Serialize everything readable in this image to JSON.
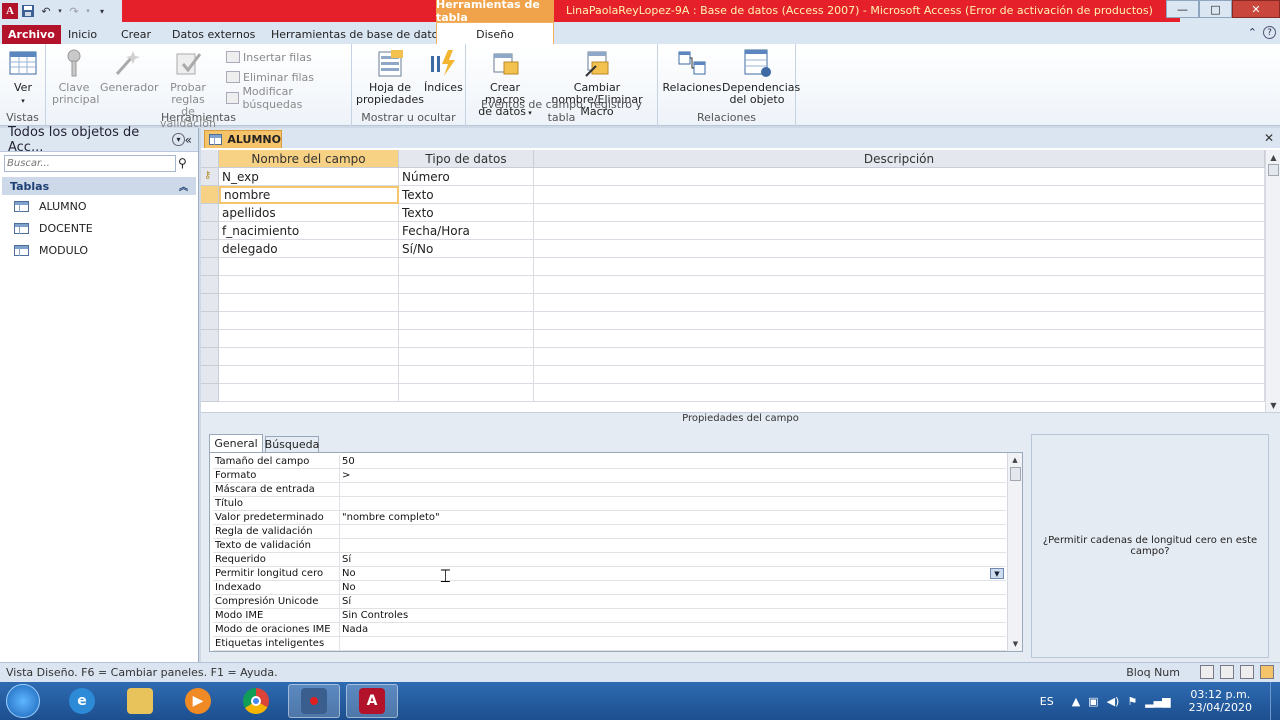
{
  "window": {
    "title": "LinaPaolaReyLopez-9A : Base de datos (Access 2007) -  Microsoft Access (Error de activación de productos)",
    "context_tab_header": "Herramientas de tabla",
    "min": "—",
    "max": "□",
    "close": "✕"
  },
  "ribbon_tabs": {
    "file": "Archivo",
    "home": "Inicio",
    "create": "Crear",
    "external": "Datos externos",
    "dbtools": "Herramientas de base de datos",
    "design": "Diseño",
    "help": "?"
  },
  "ribbon": {
    "views": {
      "view": "Ver",
      "label": "Vistas"
    },
    "tools": {
      "primary_key": "Clave\nprincipal",
      "builder": "Generador",
      "test_rules": "Probar reglas\nde validación",
      "insert_rows": "Insertar filas",
      "delete_rows": "Eliminar filas",
      "modify_lookups": "Modificar búsquedas",
      "label": "Herramientas"
    },
    "show_hide": {
      "property_sheet": "Hoja de\npropiedades",
      "indexes": "Índices",
      "label": "Mostrar u ocultar"
    },
    "events": {
      "create_macros": "Crear macros\nde datos",
      "rename_macro": "Cambiar\nnombre/Eliminar Macro",
      "label": "Eventos de campo, registro y tabla"
    },
    "relationships": {
      "relationships": "Relaciones",
      "dependencies": "Dependencias\ndel objeto",
      "label": "Relaciones"
    }
  },
  "nav": {
    "header": "Todos los objetos de Acc...",
    "search_placeholder": "Buscar...",
    "group": "Tablas",
    "items": [
      "ALUMNO",
      "DOCENTE",
      "MODULO"
    ]
  },
  "document": {
    "tab": "ALUMNO",
    "columns": {
      "name": "Nombre del campo",
      "type": "Tipo de datos",
      "desc": "Descripción"
    },
    "rows": [
      {
        "name": "N_exp",
        "type": "Número"
      },
      {
        "name": "nombre",
        "type": "Texto"
      },
      {
        "name": "apellidos",
        "type": "Texto"
      },
      {
        "name": "f_nacimiento",
        "type": "Fecha/Hora"
      },
      {
        "name": "delegado",
        "type": "Sí/No"
      }
    ]
  },
  "field_properties": {
    "title": "Propiedades del campo",
    "tab_general": "General",
    "tab_lookup": "Búsqueda",
    "props": [
      {
        "label": "Tamaño del campo",
        "value": "50"
      },
      {
        "label": "Formato",
        "value": ">"
      },
      {
        "label": "Máscara de entrada",
        "value": ""
      },
      {
        "label": "Título",
        "value": ""
      },
      {
        "label": "Valor predeterminado",
        "value": "\"nombre completo\""
      },
      {
        "label": "Regla de validación",
        "value": ""
      },
      {
        "label": "Texto de validación",
        "value": ""
      },
      {
        "label": "Requerido",
        "value": "Sí"
      },
      {
        "label": "Permitir longitud cero",
        "value": "No"
      },
      {
        "label": "Indexado",
        "value": "No"
      },
      {
        "label": "Compresión Unicode",
        "value": "Sí"
      },
      {
        "label": "Modo IME",
        "value": "Sin Controles"
      },
      {
        "label": "Modo de oraciones IME",
        "value": "Nada"
      },
      {
        "label": "Etiquetas inteligentes",
        "value": ""
      }
    ],
    "help_text": "¿Permitir cadenas de longitud cero en este campo?"
  },
  "status": {
    "left": "Vista Diseño.  F6 = Cambiar paneles.  F1 = Ayuda.",
    "numlock": "Bloq Num"
  },
  "taskbar": {
    "lang": "ES",
    "time": "03:12 p.m.",
    "date": "23/04/2020"
  },
  "colors": {
    "title_red": "#e5202b",
    "context_orange": "#f0a34a",
    "file_tab": "#b3122b",
    "selected_header": "#f7d184"
  }
}
